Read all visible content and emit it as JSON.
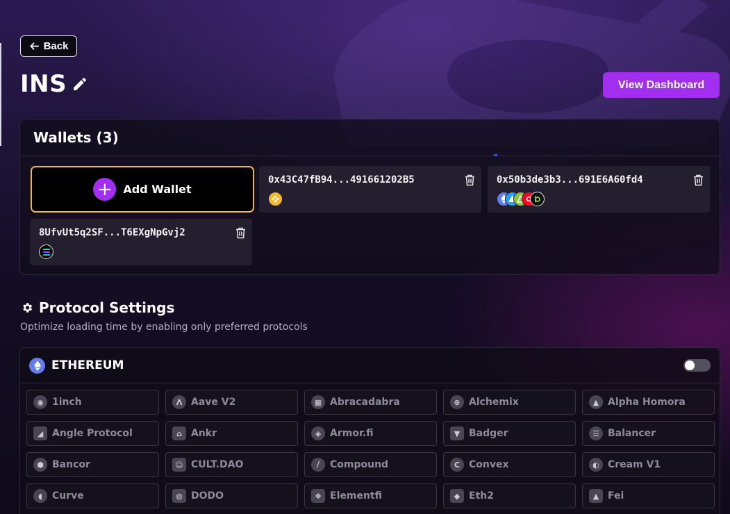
{
  "nav": {
    "back_label": "Back"
  },
  "page": {
    "title": "INS",
    "dashboard_button": "View Dashboard"
  },
  "wallets": {
    "heading": "Wallets (3)",
    "add_label": "Add Wallet",
    "items": [
      {
        "address": "0x43C47fB94...491661202B5",
        "chains": [
          "bnb-chain-icon"
        ]
      },
      {
        "address": "0x50b3de3b3...691E6A60fd4",
        "chains": [
          "ethereum-icon",
          "arbitrum-icon",
          "optimism-icon",
          "other-chain-icon"
        ]
      },
      {
        "address": "8UfvUt5q2SF...T6EXgNpGvj2",
        "chains": [
          "solana-icon"
        ]
      }
    ]
  },
  "protocol_settings": {
    "title": "Protocol Settings",
    "subtitle": "Optimize loading time by enabling only preferred protocols"
  },
  "ethereum": {
    "chain_label": "ETHEREUM",
    "toggle_on": false,
    "protocols": [
      "1inch",
      "Aave V2",
      "Abracadabra",
      "Alchemix",
      "Alpha Homora",
      "Angle Protocol",
      "Ankr",
      "Armor.fi",
      "Badger",
      "Balancer",
      "Bancor",
      "CULT.DAO",
      "Compound",
      "Convex",
      "Cream V1",
      "Curve",
      "DODO",
      "Elementfi",
      "Eth2",
      "Fei"
    ]
  },
  "colors": {
    "accent": "#a22ff0",
    "add_wallet_border": "#f6b73c",
    "bnb": "#f3ba2f",
    "ethereum": "#627eea"
  }
}
